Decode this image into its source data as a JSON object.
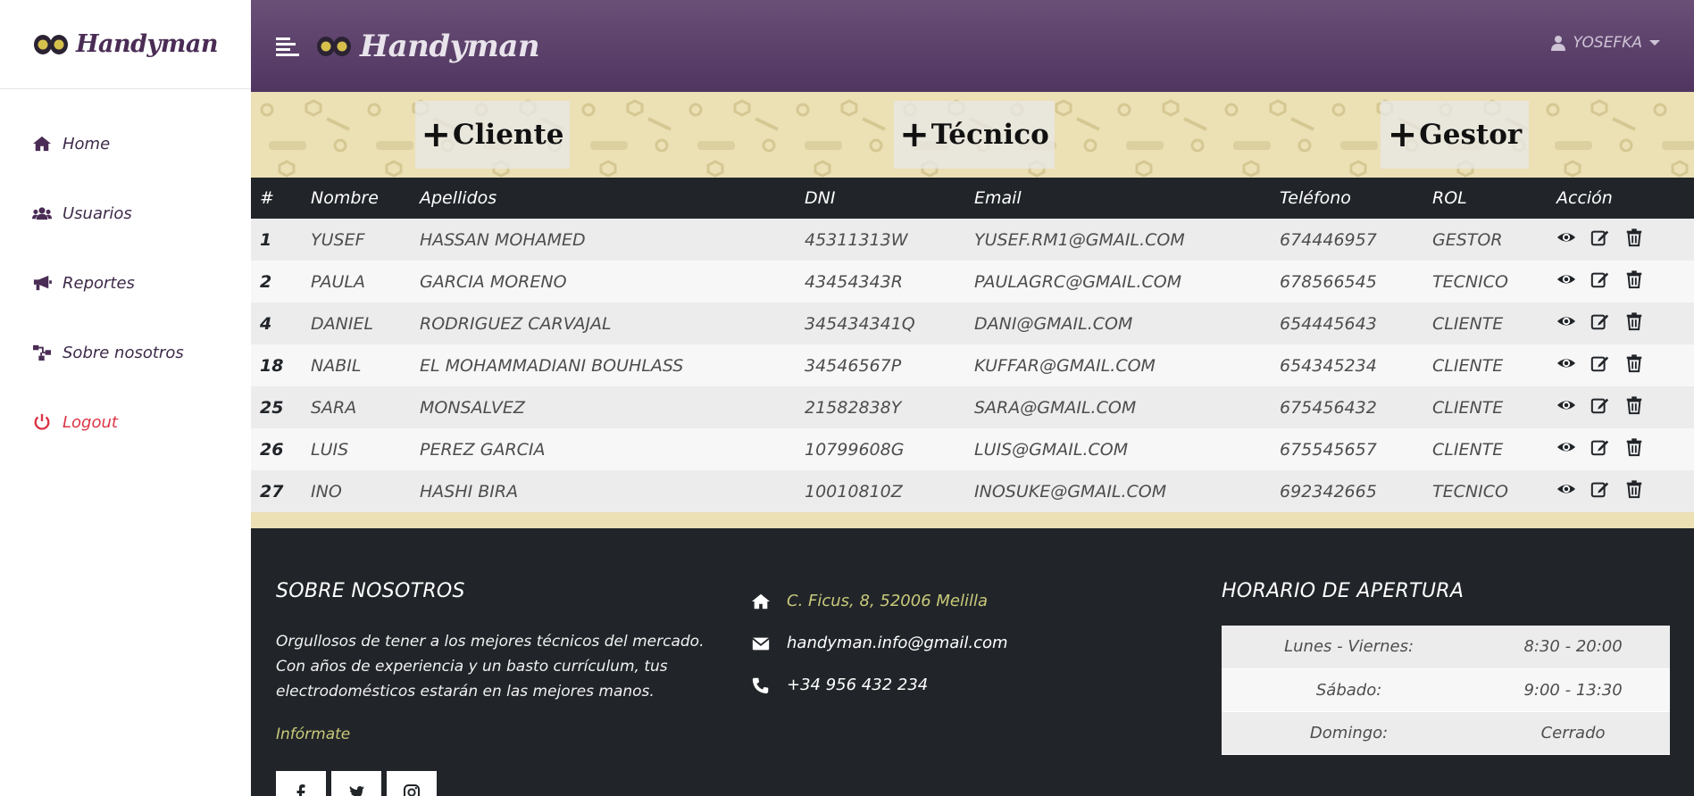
{
  "app": {
    "brand": "Handyman",
    "user": "YOSEFKA"
  },
  "sidebar": {
    "items": [
      {
        "label": "Home",
        "icon": "home-icon"
      },
      {
        "label": "Usuarios",
        "icon": "users-icon"
      },
      {
        "label": "Reportes",
        "icon": "megaphone-icon"
      },
      {
        "label": "Sobre nosotros",
        "icon": "sitemap-icon"
      },
      {
        "label": "Logout",
        "icon": "power-icon"
      }
    ]
  },
  "actions": {
    "add_cliente": "Cliente",
    "add_tecnico": "Técnico",
    "add_gestor": "Gestor"
  },
  "table": {
    "headers": [
      "#",
      "Nombre",
      "Apellidos",
      "DNI",
      "Email",
      "Teléfono",
      "ROL",
      "Acción"
    ],
    "rows": [
      {
        "id": "1",
        "nombre": "YUSEF",
        "apellidos": "HASSAN MOHAMED",
        "dni": "45311313W",
        "email": "YUSEF.RM1@GMAIL.COM",
        "telefono": "674446957",
        "rol": "GESTOR"
      },
      {
        "id": "2",
        "nombre": "PAULA",
        "apellidos": "GARCIA MORENO",
        "dni": "43454343R",
        "email": "PAULAGRC@GMAIL.COM",
        "telefono": "678566545",
        "rol": "TECNICO"
      },
      {
        "id": "4",
        "nombre": "DANIEL",
        "apellidos": "RODRIGUEZ CARVAJAL",
        "dni": "345434341Q",
        "email": "DANI@GMAIL.COM",
        "telefono": "654445643",
        "rol": "CLIENTE"
      },
      {
        "id": "18",
        "nombre": "NABIL",
        "apellidos": "EL MOHAMMADIANI BOUHLASS",
        "dni": "34546567P",
        "email": "KUFFAR@GMAIL.COM",
        "telefono": "654345234",
        "rol": "CLIENTE"
      },
      {
        "id": "25",
        "nombre": "SARA",
        "apellidos": "MONSALVEZ",
        "dni": "21582838Y",
        "email": "SARA@GMAIL.COM",
        "telefono": "675456432",
        "rol": "CLIENTE"
      },
      {
        "id": "26",
        "nombre": "LUIS",
        "apellidos": "PEREZ GARCIA",
        "dni": "10799608G",
        "email": "LUIS@GMAIL.COM",
        "telefono": "675545657",
        "rol": "CLIENTE"
      },
      {
        "id": "27",
        "nombre": "INO",
        "apellidos": "HASHI BIRA",
        "dni": "10010810Z",
        "email": "INOSUKE@GMAIL.COM",
        "telefono": "692342665",
        "rol": "TECNICO"
      }
    ]
  },
  "footer": {
    "about_title": "SOBRE NOSOTROS",
    "about_text": "Orgullosos de tener a los mejores técnicos del mercado. Con años de experiencia y un basto currículum, tus electrodomésticos estarán en las mejores manos.",
    "about_link": "Infórmate",
    "address": "C. Ficus, 8, 52006 Melilla",
    "email": "handyman.info@gmail.com",
    "phone": "+34 956 432 234",
    "hours_title": "HORARIO DE APERTURA",
    "hours": [
      {
        "day": "Lunes - Viernes:",
        "time": "8:30 - 20:00"
      },
      {
        "day": "Sábado:",
        "time": "9:00 - 13:30"
      },
      {
        "day": "Domingo:",
        "time": "Cerrado"
      }
    ],
    "socials": [
      "facebook-icon",
      "twitter-icon",
      "instagram-icon"
    ]
  },
  "colors": {
    "header": "#5b4169",
    "brand": "#4a2c55",
    "band": "#ece0b5",
    "table_head": "#212529",
    "footer": "#212529",
    "link_accent": "#c9c97a",
    "logout": "#dc3545"
  }
}
